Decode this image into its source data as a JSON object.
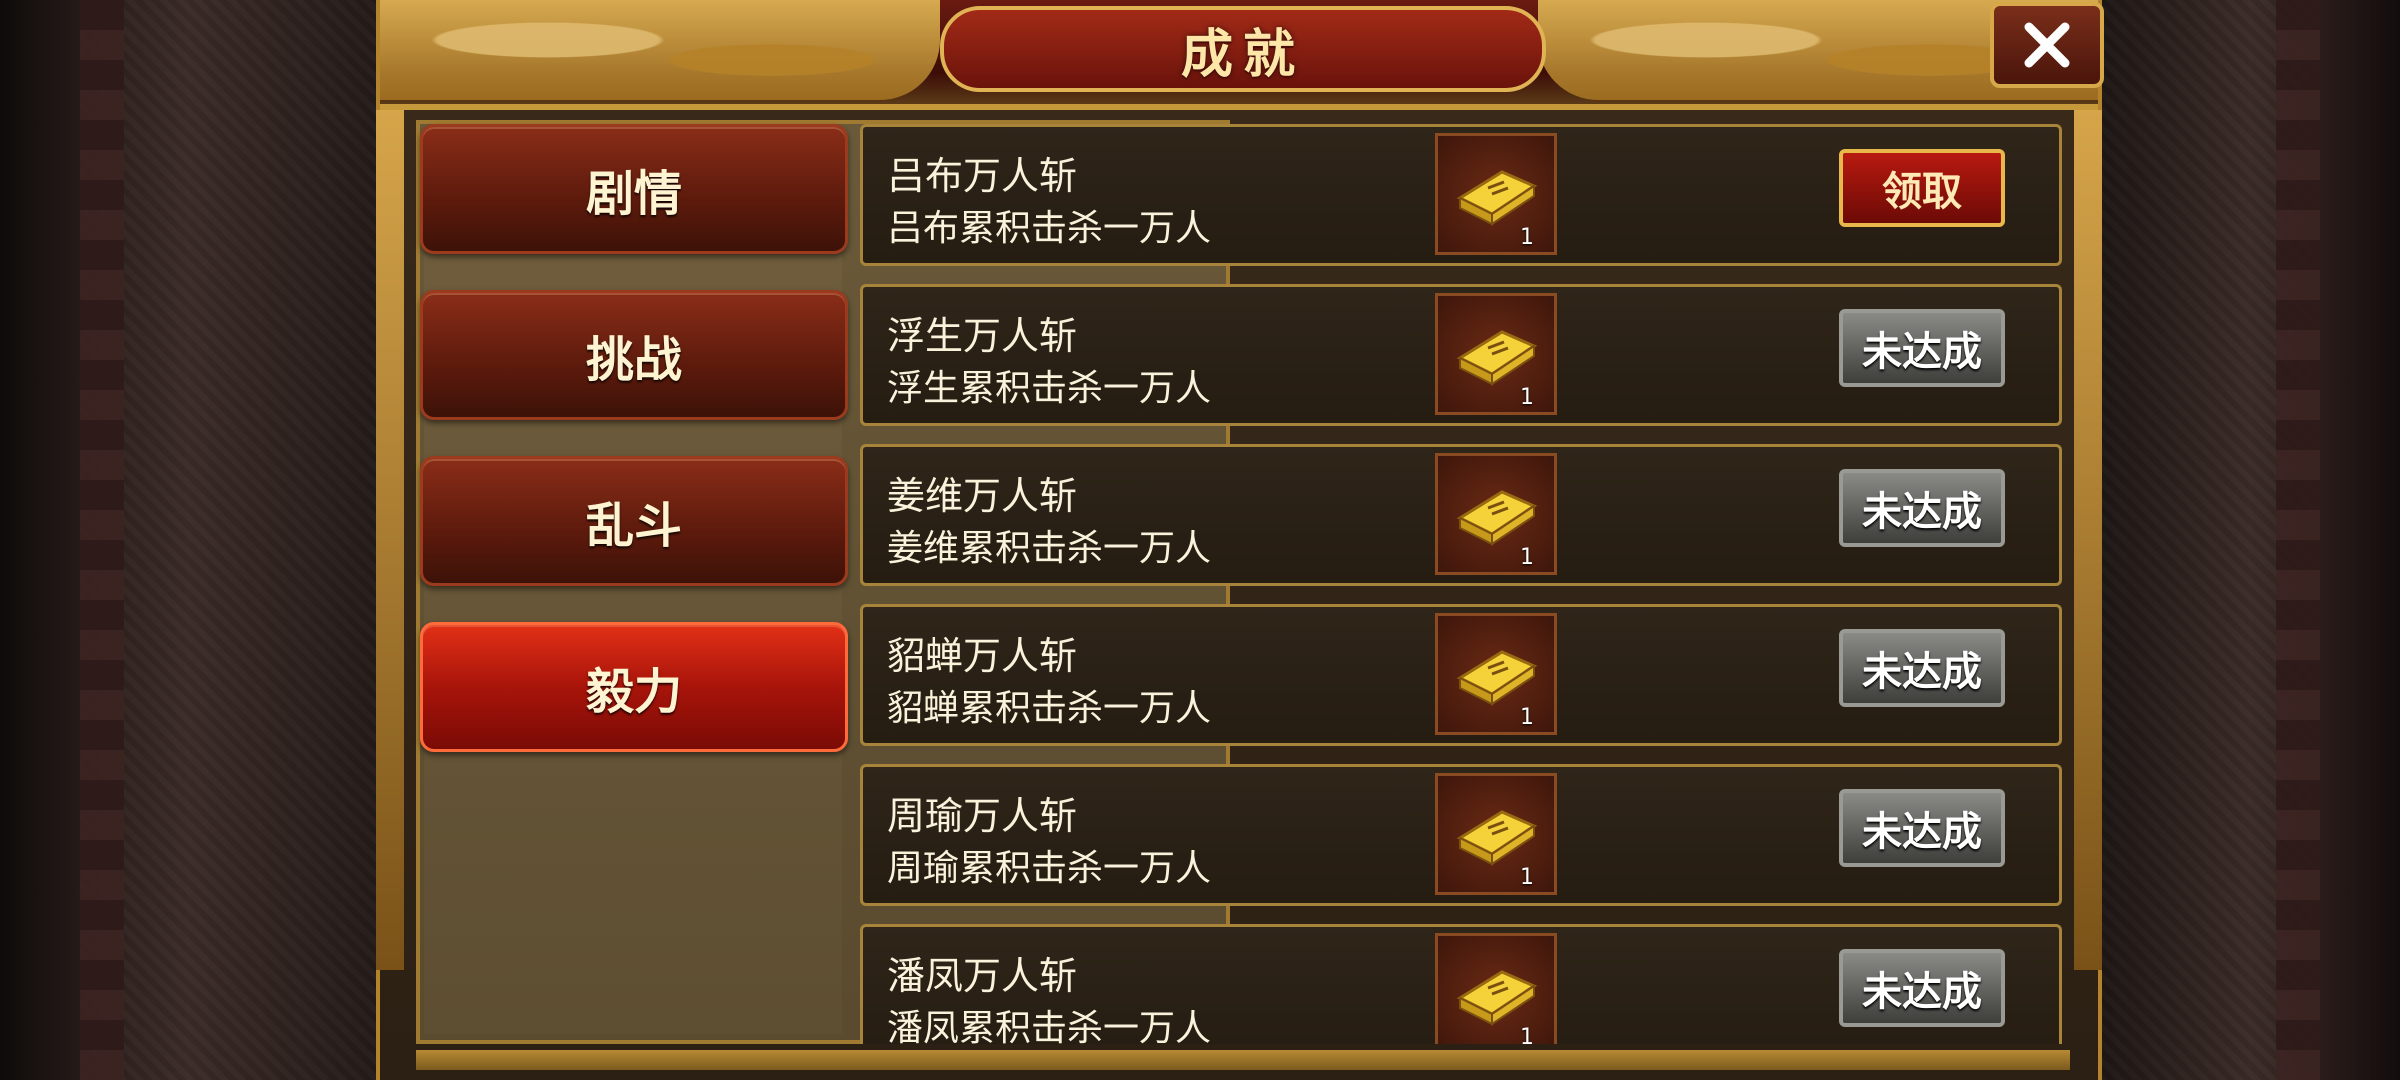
{
  "window": {
    "title": "成就",
    "close_icon": "close-x-icon"
  },
  "tabs": [
    {
      "label": "剧情",
      "active": false
    },
    {
      "label": "挑战",
      "active": false
    },
    {
      "label": "乱斗",
      "active": false
    },
    {
      "label": "毅力",
      "active": true
    }
  ],
  "achievements": [
    {
      "title": "吕布万人斩",
      "desc": "吕布累积击杀一万人",
      "reward_icon": "gold-book-icon",
      "reward_count": "1",
      "button": "领取",
      "state": "claim"
    },
    {
      "title": "浮生万人斩",
      "desc": "浮生累积击杀一万人",
      "reward_icon": "gold-book-icon",
      "reward_count": "1",
      "button": "未达成",
      "state": "locked"
    },
    {
      "title": "姜维万人斩",
      "desc": "姜维累积击杀一万人",
      "reward_icon": "gold-book-icon",
      "reward_count": "1",
      "button": "未达成",
      "state": "locked"
    },
    {
      "title": "貂蝉万人斩",
      "desc": "貂蝉累积击杀一万人",
      "reward_icon": "gold-book-icon",
      "reward_count": "1",
      "button": "未达成",
      "state": "locked"
    },
    {
      "title": "周瑜万人斩",
      "desc": "周瑜累积击杀一万人",
      "reward_icon": "gold-book-icon",
      "reward_count": "1",
      "button": "未达成",
      "state": "locked"
    },
    {
      "title": "潘凤万人斩",
      "desc": "潘凤累积击杀一万人",
      "reward_icon": "gold-book-icon",
      "reward_count": "1",
      "button": "未达成",
      "state": "locked"
    }
  ],
  "colors": {
    "accent_gold": "#c69a3a",
    "active_tab": "#d42a14",
    "claim_button": "#a81510",
    "locked_button": "#6a6a66"
  }
}
